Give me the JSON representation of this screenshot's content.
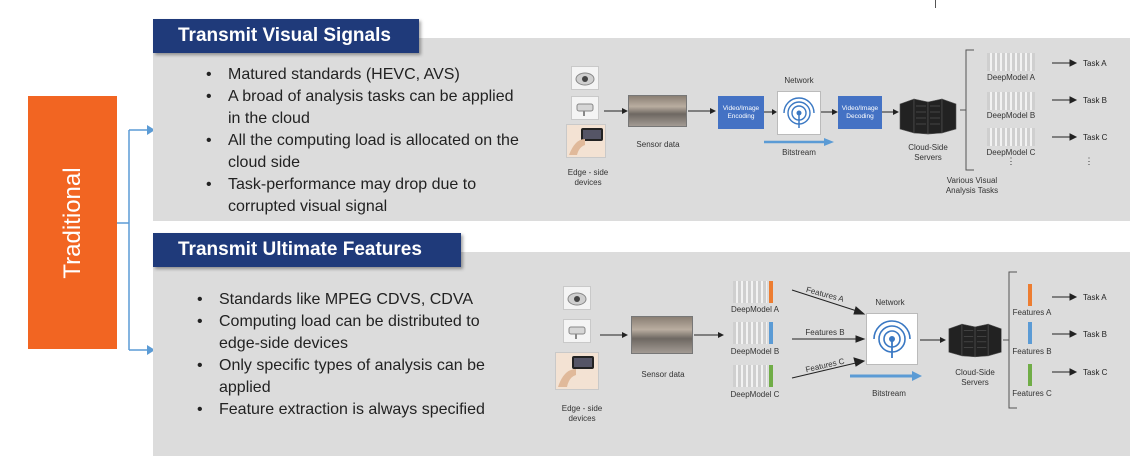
{
  "left_label": "Traditional",
  "top": {
    "title": "Transmit Visual Signals",
    "bullets": [
      "Matured standards (HEVC, AVS)",
      "A broad of analysis tasks can be applied in the cloud",
      "All the computing load is allocated on the cloud side",
      "Task-performance may drop due to corrupted visual signal"
    ],
    "diagram": {
      "edge_devices": "Edge - side devices",
      "sensor_data": "Sensor data",
      "encoding": "Video/Image Encoding",
      "network": "Network",
      "bitstream": "Bitstream",
      "decoding": "Video/Image Decoding",
      "servers": "Cloud-Side Servers",
      "models": [
        "DeepModel A",
        "DeepModel B",
        "DeepModel C"
      ],
      "tasks": [
        "Task A",
        "Task B",
        "Task C"
      ],
      "various": "Various Visual Analysis Tasks",
      "ellipsis": "⋮"
    }
  },
  "bottom": {
    "title": "Transmit Ultimate Features",
    "bullets": [
      "Standards like MPEG CDVS, CDVA",
      "Computing load can be distributed to edge-side devices",
      "Only specific types of analysis can be applied",
      "Feature extraction is always specified"
    ],
    "diagram": {
      "edge_devices": "Edge - side devices",
      "sensor_data": "Sensor data",
      "models": [
        "DeepModel A",
        "DeepModel B",
        "DeepModel C"
      ],
      "feature_arrows": [
        "Features A",
        "Features B",
        "Features C"
      ],
      "network": "Network",
      "bitstream": "Bitstream",
      "servers": "Cloud-Side Servers",
      "features": [
        "Features A",
        "Features B",
        "Features C"
      ],
      "tasks": [
        "Task A",
        "Task B",
        "Task C"
      ]
    }
  },
  "colors": {
    "title_bg": "#1f3a7a",
    "traditional_bg": "#f26522",
    "panel_bg": "#dcdcdc",
    "bracket": "#5b9bd5",
    "feature_a": "#ed7d31",
    "feature_b": "#5b9bd5",
    "feature_c": "#70ad47"
  }
}
